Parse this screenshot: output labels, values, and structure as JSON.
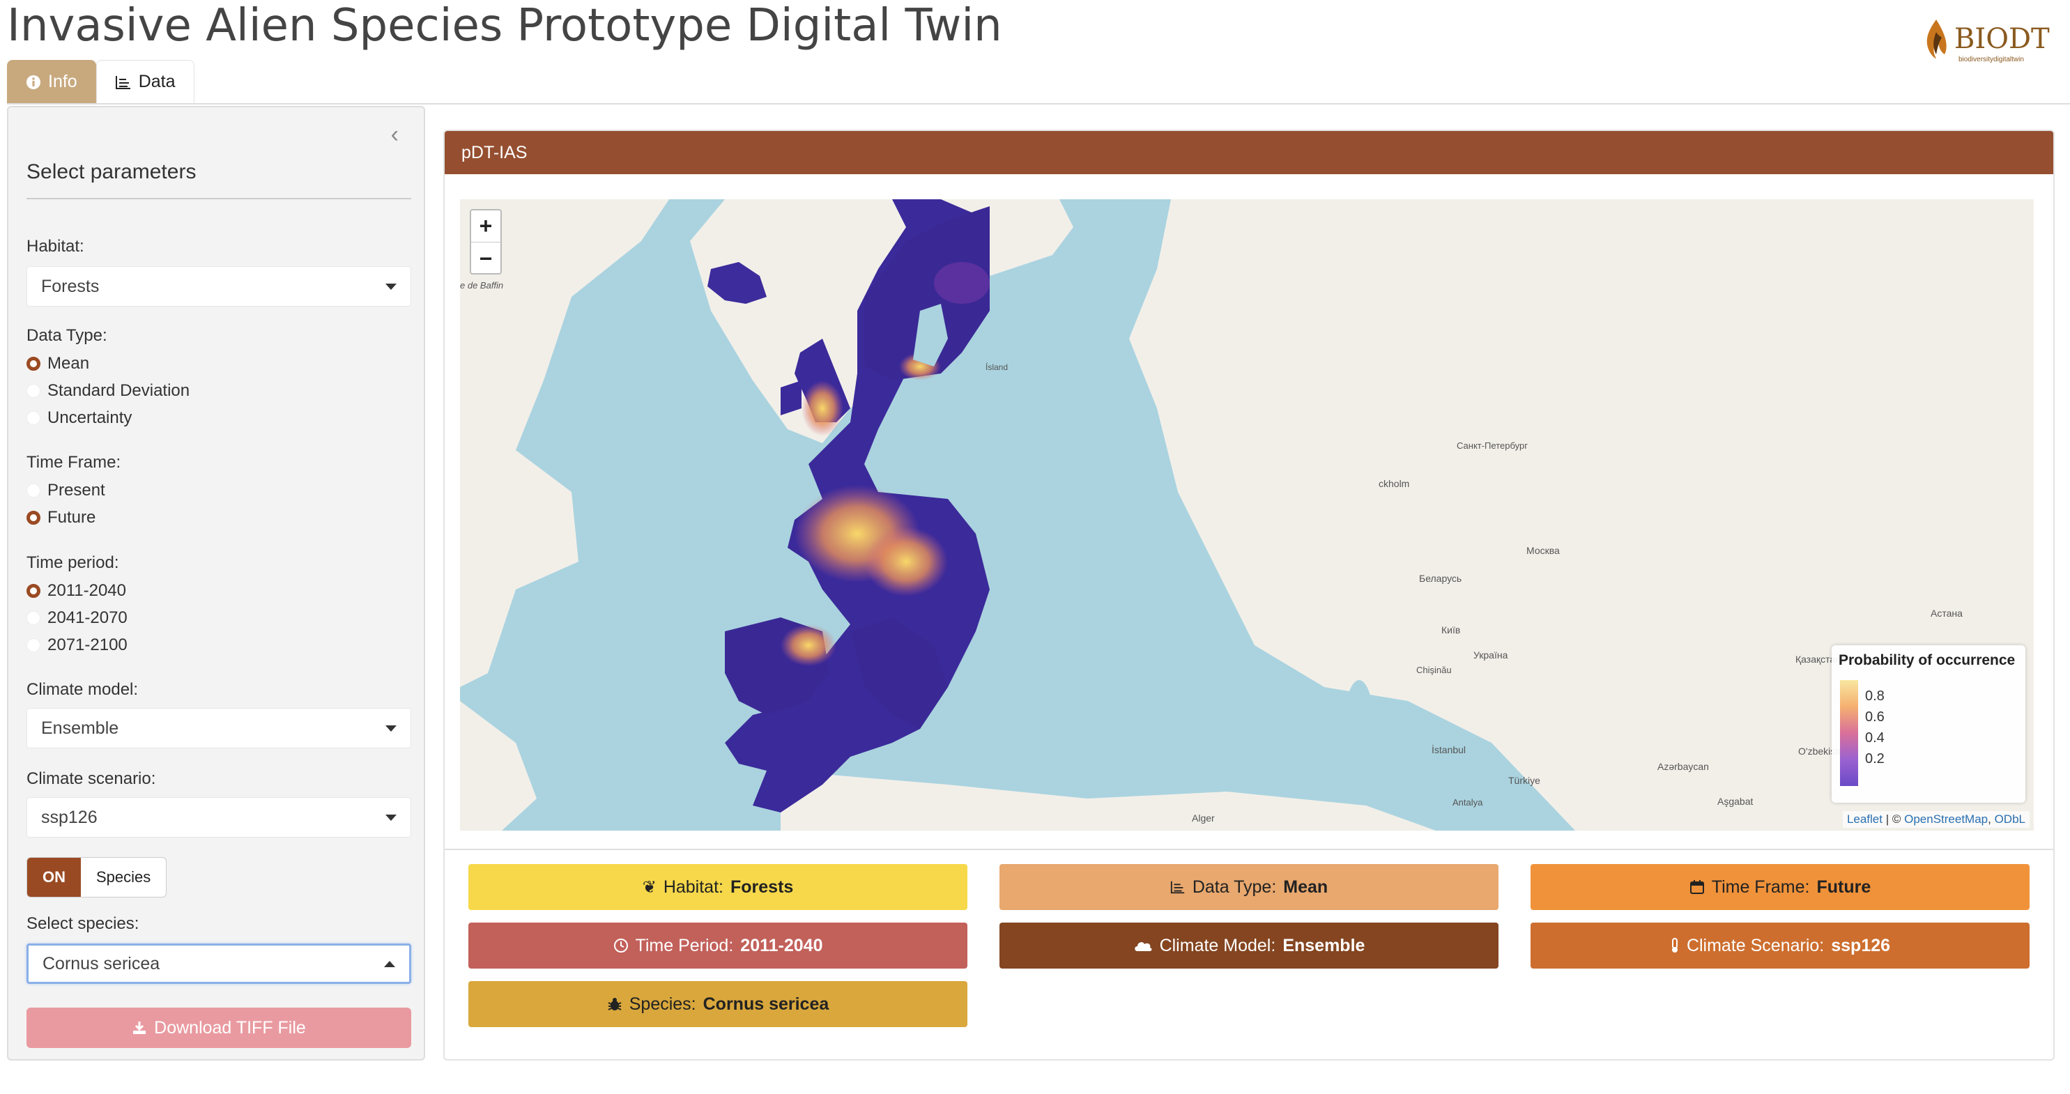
{
  "app": {
    "title": "Invasive Alien Species Prototype Digital Twin",
    "logo_text": "BIODT",
    "logo_sub": "biodiversitydigitaltwin"
  },
  "tabs": [
    {
      "label": "Info",
      "icon": "info-circle-icon",
      "active": true
    },
    {
      "label": "Data",
      "icon": "chart-icon",
      "active": false
    }
  ],
  "sidebar": {
    "title": "Select parameters",
    "habitat": {
      "label": "Habitat:",
      "value": "Forests"
    },
    "data_type": {
      "label": "Data Type:",
      "options": [
        "Mean",
        "Standard Deviation",
        "Uncertainty"
      ],
      "selected": "Mean"
    },
    "time_frame": {
      "label": "Time Frame:",
      "options": [
        "Present",
        "Future"
      ],
      "selected": "Future"
    },
    "time_period": {
      "label": "Time period:",
      "options": [
        "2011-2040",
        "2041-2070",
        "2071-2100"
      ],
      "selected": "2011-2040"
    },
    "climate_model": {
      "label": "Climate model:",
      "value": "Ensemble"
    },
    "climate_scenario": {
      "label": "Climate scenario:",
      "value": "ssp126"
    },
    "toggle": {
      "on_label": "ON",
      "off_label": "Species"
    },
    "species": {
      "label": "Select species:",
      "value": "Cornus sericea"
    },
    "download_label": "Download TIFF File"
  },
  "main": {
    "header": "pDT-IAS",
    "legend": {
      "title": "Probability of occurrence",
      "ticks": [
        "0.8",
        "0.6",
        "0.4",
        "0.2"
      ]
    },
    "attribution": {
      "leaflet": "Leaflet",
      "sep": " | © ",
      "osm": "OpenStreetMap",
      "comma": ", ",
      "odbl": "ODbL"
    },
    "zoom": {
      "in": "+",
      "out": "−"
    },
    "map_labels": {
      "iceland": "Ísland",
      "spb": "Санкт-Петербург",
      "moscow": "Москва",
      "belarus": "Беларусь",
      "kyiv": "Київ",
      "ukraine": "Україна",
      "astana": "Астана",
      "kazakhstan": "Қазақстан",
      "istanbul": "İstanbul",
      "turkiye": "Türkiye",
      "azerbaycan": "Azərbaycan",
      "ozbekiston": "O'zbekiston",
      "ashgabat": "Aşgabat",
      "antalya": "Antalya",
      "alger": "Alger",
      "chisinau": "Chişinău",
      "baffin": "e de Baffin",
      "stockholm": "ckholm"
    },
    "info_boxes": [
      {
        "label": "Habitat: ",
        "value": "Forests",
        "icon": "leaf-icon",
        "color": "#f6d84a",
        "text": "#222"
      },
      {
        "label": "Data Type: ",
        "value": "Mean",
        "icon": "chart-icon",
        "color": "#e8a86e",
        "text": "#222"
      },
      {
        "label": "Time Frame: ",
        "value": "Future",
        "icon": "calendar-icon",
        "color": "#f0923a",
        "text": "#222"
      },
      {
        "label": "Time Period: ",
        "value": "2011-2040",
        "icon": "clock-icon",
        "color": "#c2605a",
        "text": "#fff"
      },
      {
        "label": "Climate Model: ",
        "value": "Ensemble",
        "icon": "cloud-icon",
        "color": "#844520",
        "text": "#fff"
      },
      {
        "label": "Climate Scenario: ",
        "value": "ssp126",
        "icon": "thermometer-icon",
        "color": "#cd6e2e",
        "text": "#fff"
      },
      {
        "label": "Species: ",
        "value": "Cornus sericea",
        "icon": "bug-icon",
        "color": "#d9a73c",
        "text": "#222"
      }
    ]
  }
}
